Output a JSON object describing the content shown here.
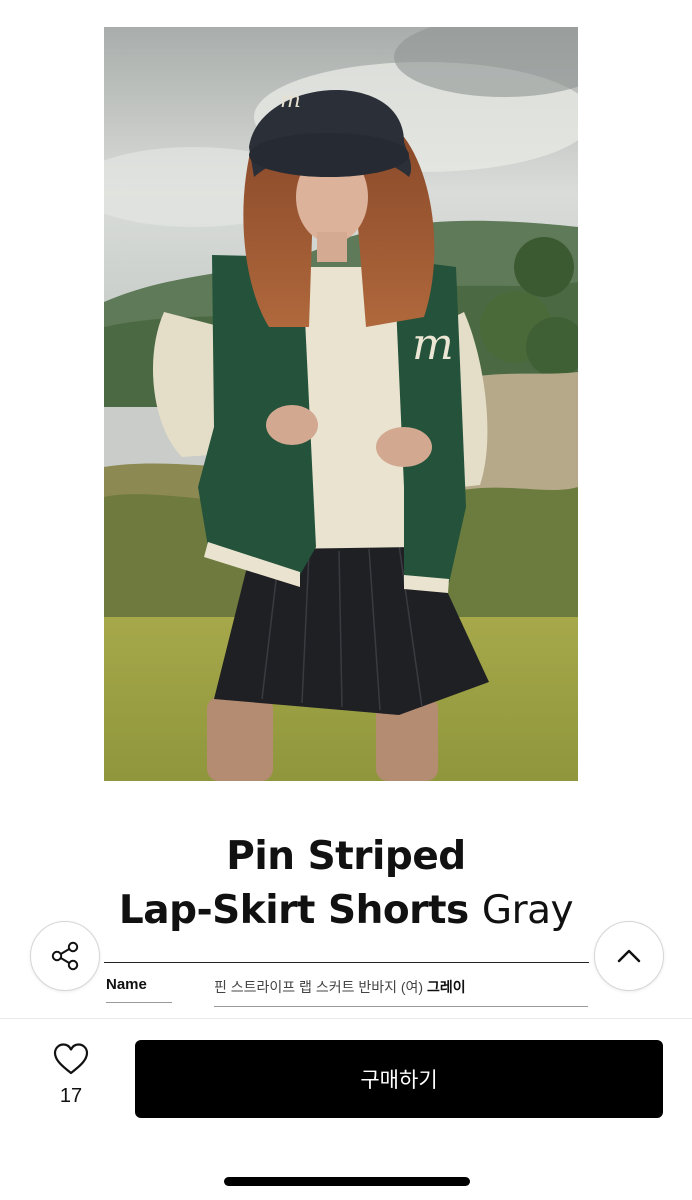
{
  "product": {
    "title_line1": "Pin Striped",
    "title_line2": "Lap-Skirt Shorts",
    "variant": "Gray",
    "photo_alt": "Model wearing green varsity vest, cream sweatshirt, bucket hat and pin striped lap-skirt shorts on a golf course"
  },
  "spec": {
    "name_label": "Name",
    "name_value_prefix": "핀 스트라이프 랩 스커트 반바지 (여) ",
    "name_value_color": "그레이"
  },
  "actions": {
    "share_icon": "share-icon",
    "scroll_top_icon": "chevron-up-icon",
    "like_icon": "heart-icon",
    "like_count": "17",
    "buy_label": "구매하기"
  },
  "colors": {
    "buy_button_bg": "#000000",
    "buy_button_text": "#ffffff",
    "text_primary": "#111111"
  }
}
